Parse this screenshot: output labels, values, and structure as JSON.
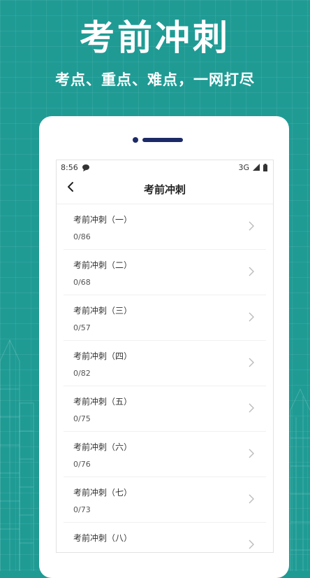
{
  "header": {
    "headline": "考前冲刺",
    "subline": "考点、重点、难点，一网打尽"
  },
  "status_bar": {
    "time": "8:56",
    "network": "3G"
  },
  "app_bar": {
    "title": "考前冲刺"
  },
  "list": [
    {
      "title": "考前冲刺（一）",
      "progress": "0/86"
    },
    {
      "title": "考前冲刺（二）",
      "progress": "0/68"
    },
    {
      "title": "考前冲刺（三）",
      "progress": "0/57"
    },
    {
      "title": "考前冲刺（四）",
      "progress": "0/82"
    },
    {
      "title": "考前冲刺（五）",
      "progress": "0/75"
    },
    {
      "title": "考前冲刺（六）",
      "progress": "0/76"
    },
    {
      "title": "考前冲刺（七）",
      "progress": "0/73"
    },
    {
      "title": "考前冲刺（八）",
      "progress": ""
    }
  ],
  "icons": {
    "back": "chevron-left-icon",
    "row": "chevron-right-icon",
    "notification": "chat-icon",
    "signal": "signal-icon",
    "battery": "battery-icon"
  },
  "colors": {
    "background": "#1f9b94",
    "frame": "#ffffff",
    "dots": "#1c2a66"
  }
}
